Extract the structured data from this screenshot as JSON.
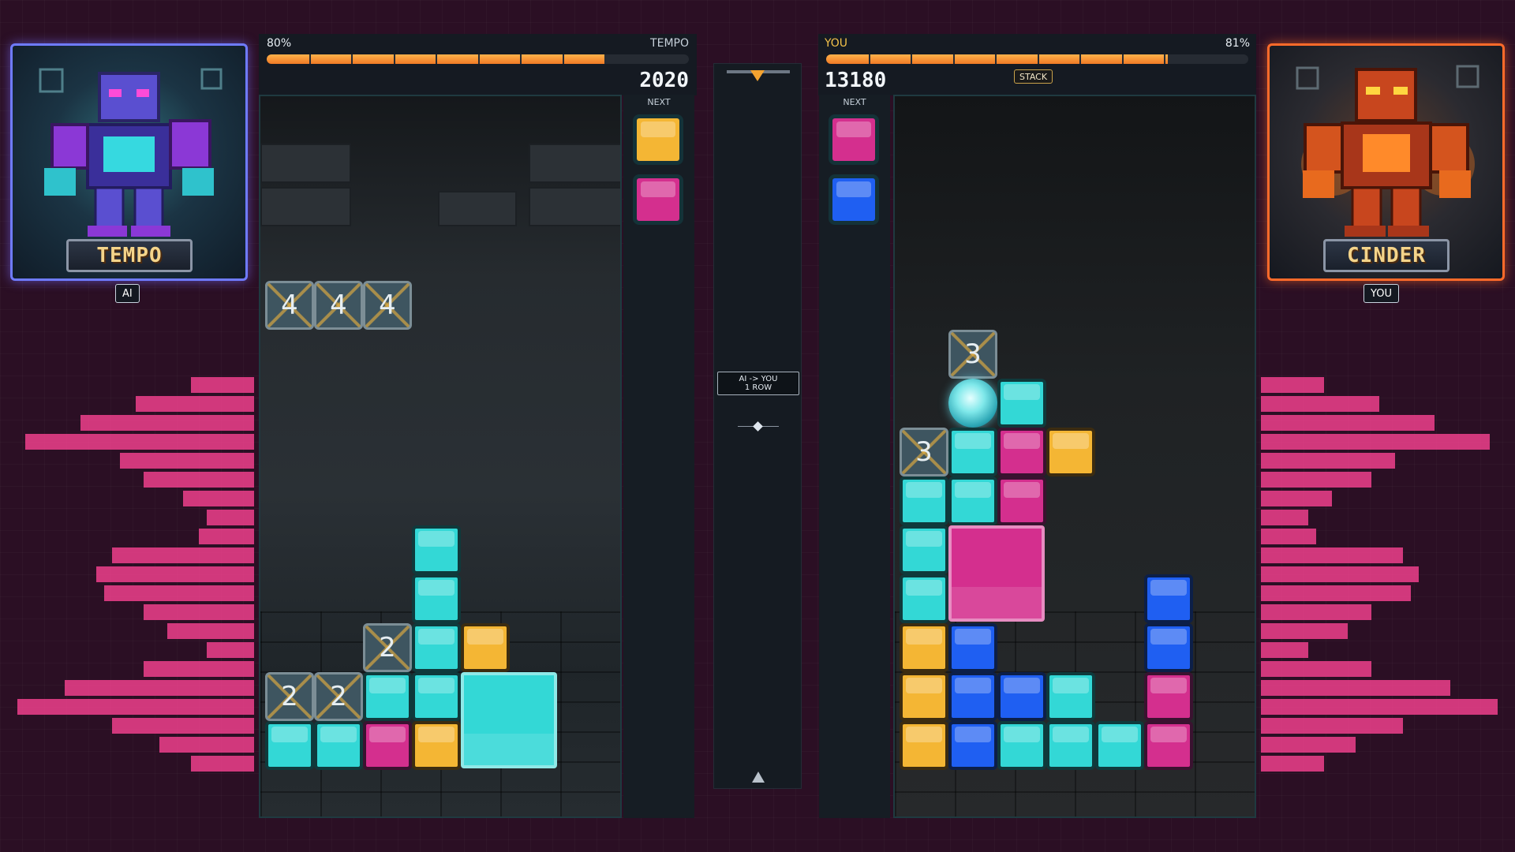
{
  "players": {
    "left": {
      "name": "TEMPO",
      "tag": "AI",
      "header_label": "TEMPO",
      "meter_percent_text": "80%",
      "meter_fraction": 0.8,
      "score": "2020",
      "next_label": "NEXT",
      "next_pieces": [
        "yellow",
        "magenta"
      ]
    },
    "right": {
      "name": "CINDER",
      "tag": "YOU",
      "header_label": "YOU",
      "meter_percent_text": "81%",
      "meter_fraction": 0.81,
      "score": "13180",
      "stack_badge": "STACK",
      "next_label": "NEXT",
      "next_pieces": [
        "magenta",
        "blue"
      ]
    }
  },
  "center": {
    "attack_line1": "AI -> YOU",
    "attack_line2": "1 ROW"
  },
  "colors": {
    "cyan": "#33d8d6",
    "magenta": "#d42f8e",
    "yellow": "#f4b634",
    "blue": "#1f5ff2",
    "meter": "#f7932f",
    "eq": "#ee3f8c"
  },
  "left_board": {
    "cells": [
      {
        "col": 0,
        "row": 2,
        "kind": "numbered",
        "value": "4"
      },
      {
        "col": 1,
        "row": 2,
        "kind": "numbered",
        "value": "4"
      },
      {
        "col": 2,
        "row": 2,
        "kind": "numbered",
        "value": "4"
      },
      {
        "col": 3,
        "row": 7,
        "kind": "cyan"
      },
      {
        "col": 3,
        "row": 8,
        "kind": "cyan"
      },
      {
        "col": 2,
        "row": 9,
        "kind": "numbered",
        "value": "2"
      },
      {
        "col": 3,
        "row": 9,
        "kind": "cyan"
      },
      {
        "col": 4,
        "row": 9,
        "kind": "yellow"
      },
      {
        "col": 0,
        "row": 10,
        "kind": "numbered",
        "value": "2"
      },
      {
        "col": 1,
        "row": 10,
        "kind": "numbered",
        "value": "2"
      },
      {
        "col": 2,
        "row": 10,
        "kind": "cyan"
      },
      {
        "col": 3,
        "row": 10,
        "kind": "cyan"
      },
      {
        "col": 0,
        "row": 11,
        "kind": "cyan"
      },
      {
        "col": 1,
        "row": 11,
        "kind": "cyan"
      },
      {
        "col": 2,
        "row": 11,
        "kind": "magenta"
      },
      {
        "col": 3,
        "row": 11,
        "kind": "yellow"
      }
    ],
    "big_pieces": [
      {
        "col": 4,
        "row": 10,
        "w": 2,
        "h": 2,
        "kind": "cyan"
      }
    ]
  },
  "right_board": {
    "cells": [
      {
        "col": 1,
        "row": 3,
        "kind": "numbered",
        "value": "3"
      },
      {
        "col": 1,
        "row": 4,
        "kind": "orb"
      },
      {
        "col": 2,
        "row": 4,
        "kind": "cyan"
      },
      {
        "col": 0,
        "row": 5,
        "kind": "numbered",
        "value": "3"
      },
      {
        "col": 1,
        "row": 5,
        "kind": "cyan"
      },
      {
        "col": 2,
        "row": 5,
        "kind": "magenta"
      },
      {
        "col": 3,
        "row": 5,
        "kind": "yellow"
      },
      {
        "col": 0,
        "row": 6,
        "kind": "cyan"
      },
      {
        "col": 1,
        "row": 6,
        "kind": "cyan"
      },
      {
        "col": 2,
        "row": 6,
        "kind": "magenta"
      },
      {
        "col": 0,
        "row": 7,
        "kind": "cyan"
      },
      {
        "col": 0,
        "row": 8,
        "kind": "cyan"
      },
      {
        "col": 5,
        "row": 8,
        "kind": "blue"
      },
      {
        "col": 0,
        "row": 9,
        "kind": "yellow"
      },
      {
        "col": 1,
        "row": 9,
        "kind": "blue"
      },
      {
        "col": 5,
        "row": 9,
        "kind": "blue"
      },
      {
        "col": 0,
        "row": 10,
        "kind": "yellow"
      },
      {
        "col": 1,
        "row": 10,
        "kind": "blue"
      },
      {
        "col": 2,
        "row": 10,
        "kind": "blue"
      },
      {
        "col": 3,
        "row": 10,
        "kind": "cyan"
      },
      {
        "col": 5,
        "row": 10,
        "kind": "magenta"
      },
      {
        "col": 0,
        "row": 11,
        "kind": "yellow"
      },
      {
        "col": 1,
        "row": 11,
        "kind": "blue"
      },
      {
        "col": 2,
        "row": 11,
        "kind": "cyan"
      },
      {
        "col": 3,
        "row": 11,
        "kind": "cyan"
      },
      {
        "col": 4,
        "row": 11,
        "kind": "cyan"
      },
      {
        "col": 5,
        "row": 11,
        "kind": "magenta"
      }
    ],
    "big_pieces": [
      {
        "col": 1,
        "row": 7,
        "w": 2,
        "h": 2,
        "kind": "magenta"
      }
    ]
  },
  "icons": {
    "ai_portrait": "robot-tempo-icon",
    "you_portrait": "robot-cinder-icon",
    "center_top_marker": "triangle-down-icon",
    "center_bottom_marker": "triangle-up-icon",
    "center_mid_marker": "diamond-icon"
  }
}
